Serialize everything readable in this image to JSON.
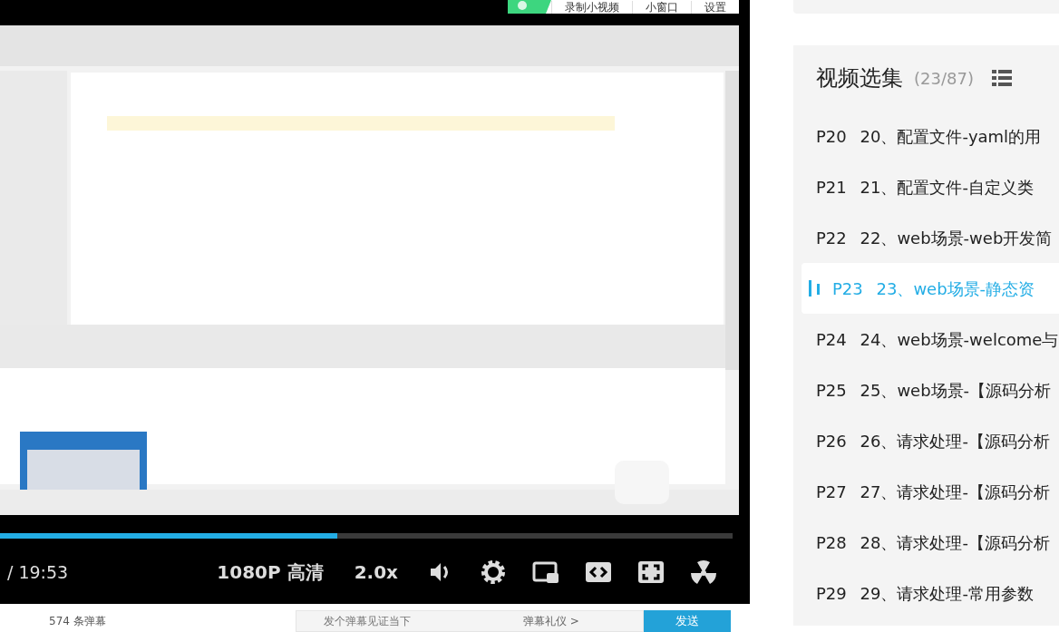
{
  "top_bar": {
    "buttons": [
      "录制小视频",
      "小窗口",
      "设置"
    ]
  },
  "player": {
    "progress": {
      "level": 0.46
    },
    "time": "/ 19:53",
    "quality": "1080P 高清",
    "speed": "2.0x"
  },
  "danmaku_bar": {
    "count": "574 条弹幕",
    "placeholder": "发个弹幕见证当下",
    "etiquette": "弹幕礼仪 >",
    "send": "发送"
  },
  "playlist": {
    "title": "视频选集",
    "count": "(23/87)",
    "items": [
      {
        "index": "P20",
        "title": "20、配置文件-yaml的用",
        "selected": false
      },
      {
        "index": "P21",
        "title": "21、配置文件-自定义类",
        "selected": false
      },
      {
        "index": "P22",
        "title": "22、web场景-web开发简",
        "selected": false
      },
      {
        "index": "P23",
        "title": "23、web场景-静态资",
        "selected": true
      },
      {
        "index": "P24",
        "title": "24、web场景-welcome与",
        "selected": false
      },
      {
        "index": "P25",
        "title": "25、web场景-【源码分析",
        "selected": false
      },
      {
        "index": "P26",
        "title": "26、请求处理-【源码分析",
        "selected": false
      },
      {
        "index": "P27",
        "title": "27、请求处理-【源码分析",
        "selected": false
      },
      {
        "index": "P28",
        "title": "28、请求处理-【源码分析",
        "selected": false
      },
      {
        "index": "P29",
        "title": "29、请求处理-常用参数",
        "selected": false
      }
    ]
  }
}
